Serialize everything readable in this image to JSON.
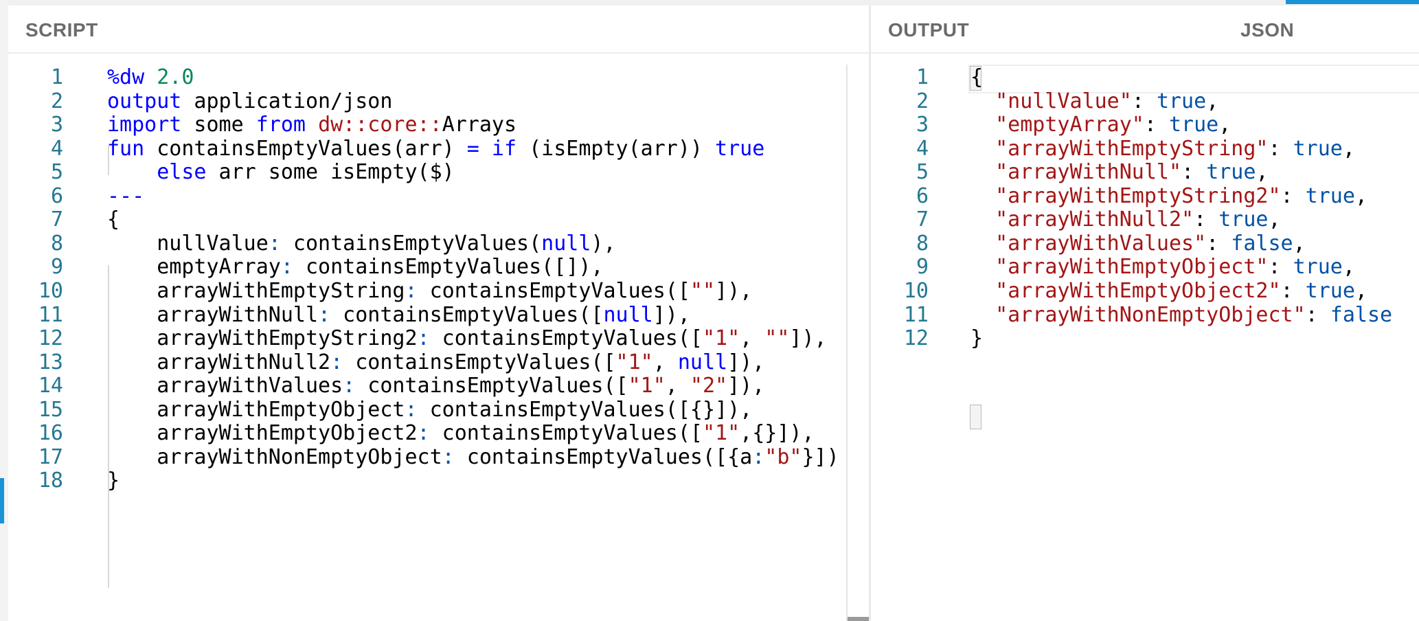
{
  "script_panel": {
    "title": "SCRIPT",
    "lines": [
      {
        "n": "1",
        "html": "<span class=\"kw\">%dw</span> <span class=\"num\">2.0</span>"
      },
      {
        "n": "2",
        "html": "<span class=\"kw\">output</span> application/json"
      },
      {
        "n": "3",
        "html": "<span class=\"kw\">import</span> some <span class=\"kw\">from</span> <span class=\"ns\">dw::core::</span>Arrays"
      },
      {
        "n": "4",
        "html": "<span class=\"kw\">fun</span> containsEmptyValues(arr) <span class=\"kw\">=</span> <span class=\"kw\">if</span> (isEmpty(arr)) <span class=\"kw\">true</span>"
      },
      {
        "n": "5",
        "html": "    <span class=\"kw\">else</span> arr some isEmpty($)"
      },
      {
        "n": "6",
        "html": "<span class=\"kw\">---</span>"
      },
      {
        "n": "7",
        "html": "{"
      },
      {
        "n": "8",
        "html": "    nullValue<span class=\"pun\">:</span> containsEmptyValues(<span class=\"kw\">null</span>),"
      },
      {
        "n": "9",
        "html": "    emptyArray<span class=\"pun\">:</span> containsEmptyValues([]),"
      },
      {
        "n": "10",
        "html": "    arrayWithEmptyString<span class=\"pun\">:</span> containsEmptyValues([<span class=\"str\">\"\"</span>]),"
      },
      {
        "n": "11",
        "html": "    arrayWithNull<span class=\"pun\">:</span> containsEmptyValues([<span class=\"kw\">null</span>]),"
      },
      {
        "n": "12",
        "html": "    arrayWithEmptyString2<span class=\"pun\">:</span> containsEmptyValues([<span class=\"str\">\"1\"</span>, <span class=\"str\">\"\"</span>]),"
      },
      {
        "n": "13",
        "html": "    arrayWithNull2<span class=\"pun\">:</span> containsEmptyValues([<span class=\"str\">\"1\"</span>, <span class=\"kw\">null</span>]),"
      },
      {
        "n": "14",
        "html": "    arrayWithValues<span class=\"pun\">:</span> containsEmptyValues([<span class=\"str\">\"1\"</span>, <span class=\"str\">\"2\"</span>]),"
      },
      {
        "n": "15",
        "html": "    arrayWithEmptyObject<span class=\"pun\">:</span> containsEmptyValues([{}]),"
      },
      {
        "n": "16",
        "html": "    arrayWithEmptyObject2<span class=\"pun\">:</span> containsEmptyValues([<span class=\"str\">\"1\"</span>,{}]),"
      },
      {
        "n": "17",
        "html": "    arrayWithNonEmptyObject<span class=\"pun\">:</span> containsEmptyValues([{a<span class=\"pun\">:</span><span class=\"str\">\"b\"</span>}])"
      },
      {
        "n": "18",
        "html": "}"
      }
    ]
  },
  "output_panel": {
    "title": "OUTPUT",
    "format": "JSON",
    "lines": [
      {
        "n": "1",
        "html": "{"
      },
      {
        "n": "2",
        "html": "  <span class=\"key\">\"nullValue\"</span>: <span class=\"bool\">true</span>,"
      },
      {
        "n": "3",
        "html": "  <span class=\"key\">\"emptyArray\"</span>: <span class=\"bool\">true</span>,"
      },
      {
        "n": "4",
        "html": "  <span class=\"key\">\"arrayWithEmptyString\"</span>: <span class=\"bool\">true</span>,"
      },
      {
        "n": "5",
        "html": "  <span class=\"key\">\"arrayWithNull\"</span>: <span class=\"bool\">true</span>,"
      },
      {
        "n": "6",
        "html": "  <span class=\"key\">\"arrayWithEmptyString2\"</span>: <span class=\"bool\">true</span>,"
      },
      {
        "n": "7",
        "html": "  <span class=\"key\">\"arrayWithNull2\"</span>: <span class=\"bool\">true</span>,"
      },
      {
        "n": "8",
        "html": "  <span class=\"key\">\"arrayWithValues\"</span>: <span class=\"bool\">false</span>,"
      },
      {
        "n": "9",
        "html": "  <span class=\"key\">\"arrayWithEmptyObject\"</span>: <span class=\"bool\">true</span>,"
      },
      {
        "n": "10",
        "html": "  <span class=\"key\">\"arrayWithEmptyObject2\"</span>: <span class=\"bool\">true</span>,"
      },
      {
        "n": "11",
        "html": "  <span class=\"key\">\"arrayWithNonEmptyObject\"</span>: <span class=\"bool\">false</span>"
      },
      {
        "n": "12",
        "html": "}"
      }
    ]
  }
}
